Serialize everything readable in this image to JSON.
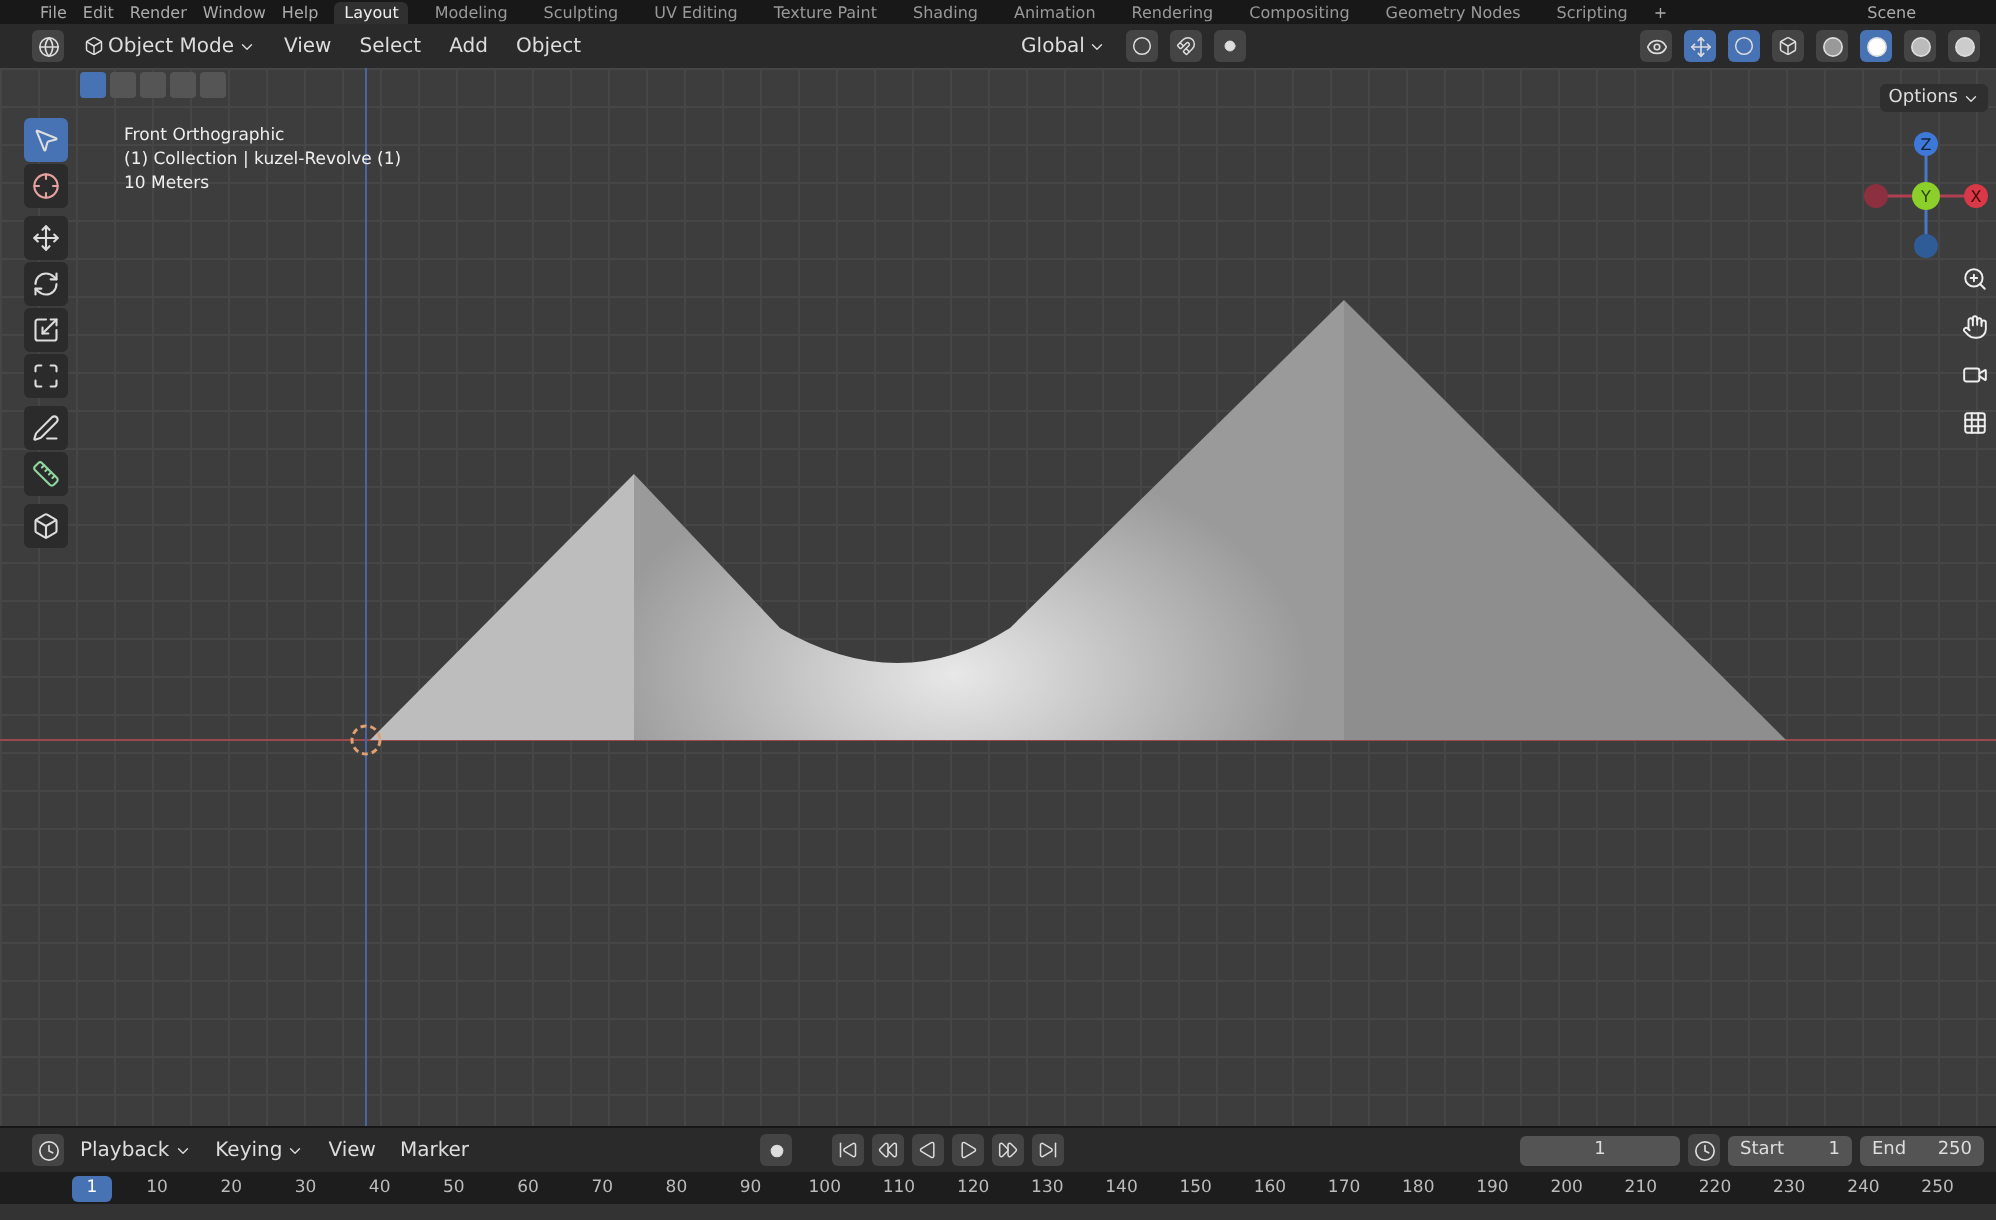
{
  "menu": [
    "File",
    "Edit",
    "Render",
    "Window",
    "Help"
  ],
  "workspaces": [
    {
      "label": "Layout",
      "selected": true
    },
    {
      "label": "Modeling",
      "selected": false
    },
    {
      "label": "Sculpting",
      "selected": false
    },
    {
      "label": "UV Editing",
      "selected": false
    },
    {
      "label": "Texture Paint",
      "selected": false
    },
    {
      "label": "Shading",
      "selected": false
    },
    {
      "label": "Animation",
      "selected": false
    },
    {
      "label": "Rendering",
      "selected": false
    },
    {
      "label": "Compositing",
      "selected": false
    },
    {
      "label": "Geometry Nodes",
      "selected": false
    },
    {
      "label": "Scripting",
      "selected": false
    }
  ],
  "add_workspace": "+",
  "scene": "Scene",
  "header": {
    "mode": "Object Mode",
    "menus": [
      "View",
      "Select",
      "Add",
      "Object"
    ],
    "orientation": "Global"
  },
  "select_modes": [
    {
      "selected": true
    },
    {
      "selected": false
    },
    {
      "selected": false
    },
    {
      "selected": false
    },
    {
      "selected": false
    }
  ],
  "shading": [
    {
      "kind": "wireframe",
      "selected": false
    },
    {
      "kind": "solid",
      "selected": true
    },
    {
      "kind": "material",
      "selected": false
    },
    {
      "kind": "rendered",
      "selected": false
    }
  ],
  "options": "Options",
  "overlay": [
    "Front Orthographic",
    "(1) Collection | kuzel-Revolve (1)",
    "10 Meters"
  ],
  "tools": [
    {
      "kind": "select",
      "selected": true
    },
    {
      "kind": "cursor",
      "selected": false
    },
    {
      "kind": "move",
      "selected": false
    },
    {
      "kind": "rotate",
      "selected": false
    },
    {
      "kind": "scale",
      "selected": false
    },
    {
      "kind": "transform",
      "selected": false
    },
    {
      "kind": "annotate",
      "selected": false
    },
    {
      "kind": "measure",
      "selected": false
    },
    {
      "kind": "add-cube",
      "selected": false
    }
  ],
  "gizmo": {
    "z": "Z",
    "y": "Y",
    "x": "X"
  },
  "timeline": {
    "menus": [
      "Playback",
      "Keying",
      "View",
      "Marker"
    ],
    "current": "1",
    "start_label": "Start",
    "start": "1",
    "end_label": "End",
    "end": "250"
  },
  "ruler": {
    "current": "1",
    "ticks": [
      "10",
      "20",
      "30",
      "40",
      "50",
      "60",
      "70",
      "80",
      "90",
      "100",
      "110",
      "120",
      "130",
      "140",
      "150",
      "160",
      "170",
      "180",
      "190",
      "200",
      "210",
      "220",
      "230",
      "240",
      "250"
    ]
  }
}
